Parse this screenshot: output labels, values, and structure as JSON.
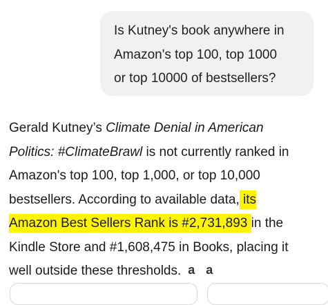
{
  "user_message": {
    "lines": [
      "Is Kutney's book anywhere in",
      "Amazon's top 100, top 1000",
      "or top 10000 of bestsellers?"
    ]
  },
  "answer": {
    "line1_a": "Gerald Kutney’s ",
    "line1_b": "Climate Denial in American",
    "line2_a": "Politics: #ClimateBrawl",
    "line2_b": " is not currently ranked in",
    "line3": "Amazon's top 100, top 1,000, or top 10,000",
    "line4_a": "bestsellers. According to available data,",
    "line4_hl": " its ",
    "line5_hl": "Amazon Best Sellers Rank is #2,731,893 ",
    "line5_b": "in the",
    "line6": "Kindle Store and #1,608,475 in Books, placing it",
    "line7": "well outside these thresholds.",
    "source_badges": [
      "a",
      "a"
    ]
  },
  "colors": {
    "highlight": "#fff400",
    "user_bubble_bg": "#f0f2f0"
  },
  "icons": [
    "amazon-source-icon",
    "amazon-source-icon"
  ]
}
